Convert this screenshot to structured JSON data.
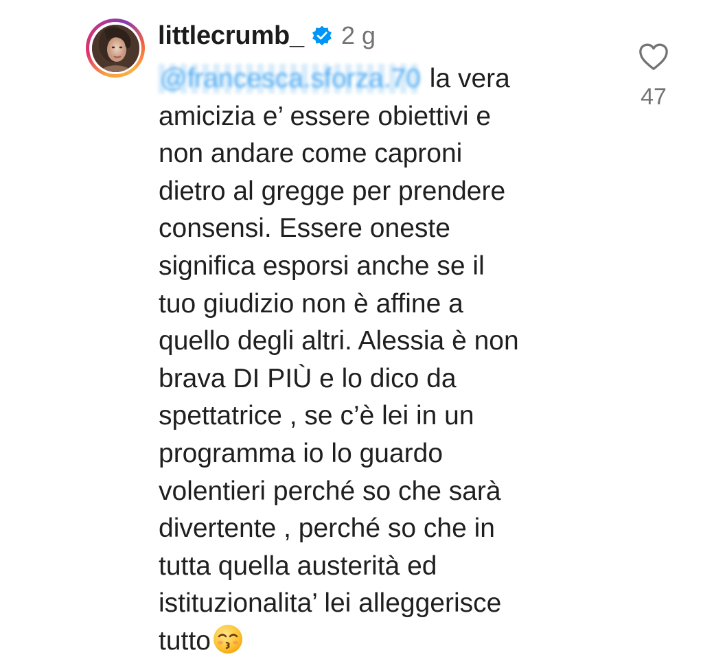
{
  "comment": {
    "username": "littlecrumb_",
    "verified": true,
    "timestamp": "2 g",
    "mention_blurred": "@francesca.sforza.70",
    "lines": [
      "la vera",
      "amicizia e’ essere obiettivi e",
      "non andare come caproni",
      "dietro al gregge per prendere",
      "consensi. Essere oneste",
      "significa esporsi anche se il",
      "tuo giudizio non è affine a",
      "quello degli altri. Alessia è non",
      "brava DI PIÙ e lo dico da",
      "spettatrice , se c’è lei in un",
      "programma io lo guardo",
      "volentieri perché so che sarà",
      "divertente , perché so che in",
      "tutta quella austerità ed",
      "istituzionalita’ lei alleggerisce",
      "tutto"
    ],
    "trailing_emoji": "kissing-face-with-smiling-eyes-icon"
  },
  "like": {
    "icon": "heart-outline-icon",
    "count": "47"
  },
  "colors": {
    "text": "#1c1c1c",
    "muted": "#737373",
    "mention": "#2e9bf0",
    "verified_badge": "#0095f6"
  }
}
